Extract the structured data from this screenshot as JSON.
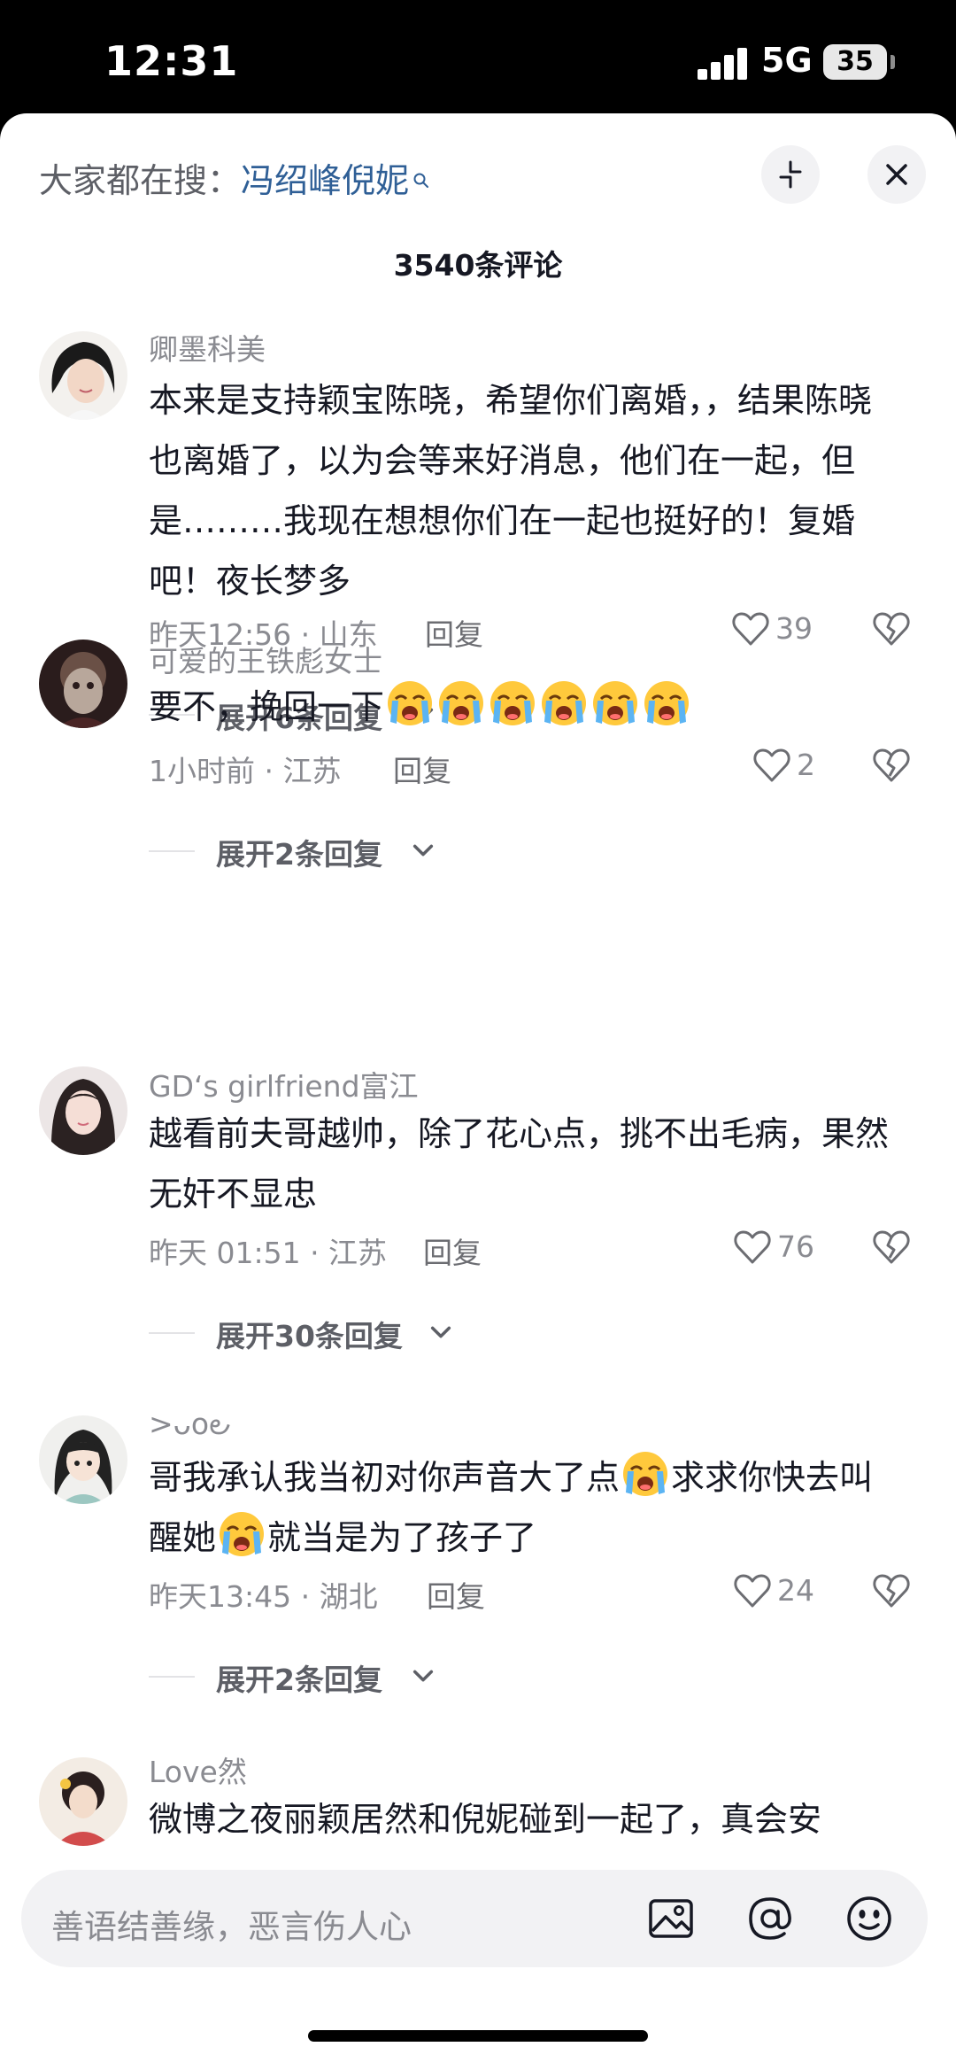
{
  "status": {
    "time": "12:31",
    "network": "5G",
    "battery": "35"
  },
  "header": {
    "prefix": "大家都在搜：",
    "term": "冯绍峰倪妮"
  },
  "comment_count": "3540条评论",
  "icons": {
    "collapse": "collapse-icon",
    "close": "close-icon",
    "like": "heart-outline-icon",
    "dislike": "broken-heart-icon",
    "image": "image-icon",
    "mention": "at-icon",
    "emoji": "emoji-icon",
    "crying": "crying-face-emoji"
  },
  "comments": [
    {
      "user": "卿墨科美",
      "text": "本来是支持颖宝陈晓，希望你们离婚，，结果陈晓也离婚了，以为会等来好消息，他们在一起，但是………我现在想想你们在一起也挺好的！复婚吧！夜长梦多",
      "meta": "昨天12:56 · 山东",
      "reply": "回复",
      "likes": "39",
      "expand": "展开6条回复"
    },
    {
      "user": "可爱的王铁彪女士",
      "text": "要不，挽回一下",
      "meta": "1小时前 · 江苏",
      "reply": "回复",
      "likes": "2",
      "expand": "展开2条回复"
    },
    {
      "user": "GD‘s girlfriend富江",
      "text": "越看前夫哥越帅，除了花心点，挑不出毛病，果然无奸不显忠",
      "meta": "昨天 01:51 · 江苏",
      "reply": "回复",
      "likes": "76",
      "expand": "展开30条回复"
    },
    {
      "user": ">ᴗo౿",
      "text_a": "哥我承认我当初对你声音大了点",
      "text_b": "求求你快去叫醒她",
      "text_c": "就当是为了孩子了",
      "meta": "昨天13:45 · 湖北",
      "reply": "回复",
      "likes": "24",
      "expand": "展开2条回复"
    },
    {
      "user": "Love然",
      "text": "微博之夜丽颖居然和倪妮碰到一起了，真会安"
    }
  ],
  "input": {
    "placeholder": "善语结善缘，恶言伤人心"
  }
}
